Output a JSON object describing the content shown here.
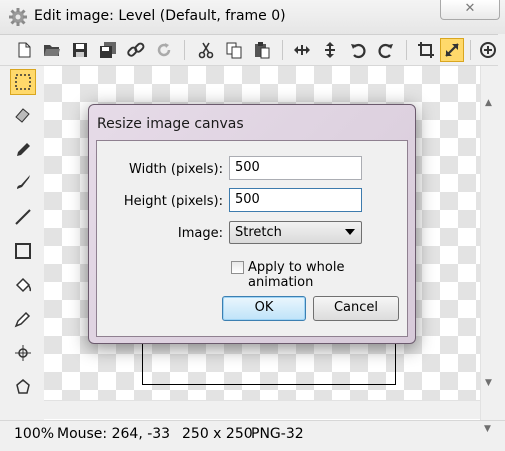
{
  "window": {
    "title": "Edit image: Level (Default, frame 0)",
    "close_label": "✕"
  },
  "toolbar": {
    "icons": [
      "new-file-icon",
      "open-folder-icon",
      "save-icon",
      "save-all-icon",
      "link-icon",
      "refresh-icon",
      "cut-icon",
      "copy-icon",
      "paste-icon",
      "move-horizontal-icon",
      "move-vertical-icon",
      "undo-icon",
      "redo-icon",
      "crop-icon",
      "resize-icon",
      "zoom-in-icon"
    ]
  },
  "tools": [
    "selection-tool-icon",
    "eraser-icon",
    "pencil-icon",
    "brush-icon",
    "line-icon",
    "rectangle-icon",
    "fill-bucket-icon",
    "eyedropper-icon",
    "origin-icon",
    "polygon-icon"
  ],
  "dialog": {
    "title": "Resize image canvas",
    "width_label": "Width (pixels):",
    "width_value": "500",
    "height_label": "Height (pixels):",
    "height_value": "500",
    "image_label": "Image:",
    "image_option": "Stretch",
    "apply_label": "Apply to whole animation",
    "apply_checked": false,
    "ok_label": "OK",
    "cancel_label": "Cancel"
  },
  "status": {
    "zoom": "100%",
    "mouse": "Mouse: 264, -33",
    "size": "250 x 250",
    "format": "PNG-32"
  },
  "colors": {
    "accent_active": "#ffd96b",
    "dialog_frame": "#d7cad9",
    "default_button": "#bfe3f9"
  }
}
